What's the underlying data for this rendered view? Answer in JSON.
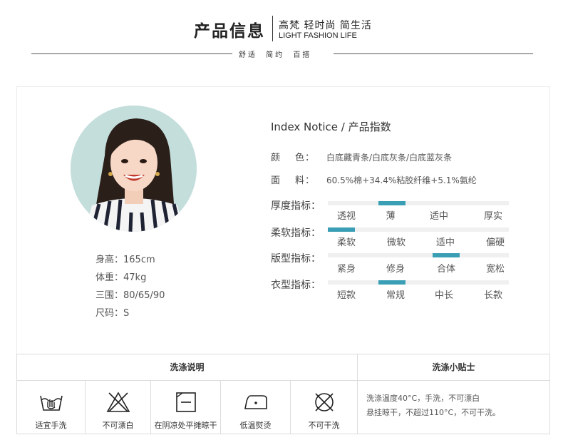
{
  "header": {
    "title": "产品信息",
    "sub_cn": "高梵 轻时尚 简生活",
    "sub_en": "LIGHT FASHION LIFE",
    "tagline": "舒适 简约 百搭"
  },
  "model": {
    "height": "身高：165cm",
    "weight": "体重：47kg",
    "measurements": "三围：80/65/90",
    "size": "尺码：S"
  },
  "index_title": "Index Notice / 产品指数",
  "props": [
    {
      "label_a": "颜",
      "label_b": "色：",
      "value": "白底藏青条/白底灰条/白底蓝灰条"
    },
    {
      "label_a": "面",
      "label_b": "料：",
      "value": "60.5%棉+34.4%粘胶纤维+5.1%氨纶"
    }
  ],
  "metrics": [
    {
      "label": "厚度指标：",
      "options": [
        "透视",
        "薄",
        "适中",
        "厚实"
      ],
      "selected_index": 1
    },
    {
      "label": "柔软指标：",
      "options": [
        "柔软",
        "微软",
        "适中",
        "偏硬"
      ],
      "selected_index": 0
    },
    {
      "label": "版型指标：",
      "options": [
        "紧身",
        "修身",
        "合体",
        "宽松"
      ],
      "selected_index": 2
    },
    {
      "label": "衣型指标：",
      "options": [
        "短款",
        "常规",
        "中长",
        "长款"
      ],
      "selected_index": 1
    }
  ],
  "care": {
    "header_left": "洗涤说明",
    "header_right": "洗涤小贴士",
    "items": [
      {
        "icon": "hand-wash-icon",
        "label": "适宜手洗"
      },
      {
        "icon": "no-bleach-icon",
        "label": "不可漂白"
      },
      {
        "icon": "shade-dry-flat-icon",
        "label": "在阴凉处平摊晾干"
      },
      {
        "icon": "low-iron-icon",
        "label": "低温熨烫"
      },
      {
        "icon": "no-dry-clean-icon",
        "label": "不可干洗"
      }
    ],
    "tips_line1": "洗涤温度40°C，手洗，不可漂白",
    "tips_line2": "悬挂晾干，不超过110°C，不可干洗。"
  },
  "colors": {
    "accent": "#3a9fb5",
    "avatar_bg": "#c4dedc",
    "track": "#f0f0f0"
  }
}
